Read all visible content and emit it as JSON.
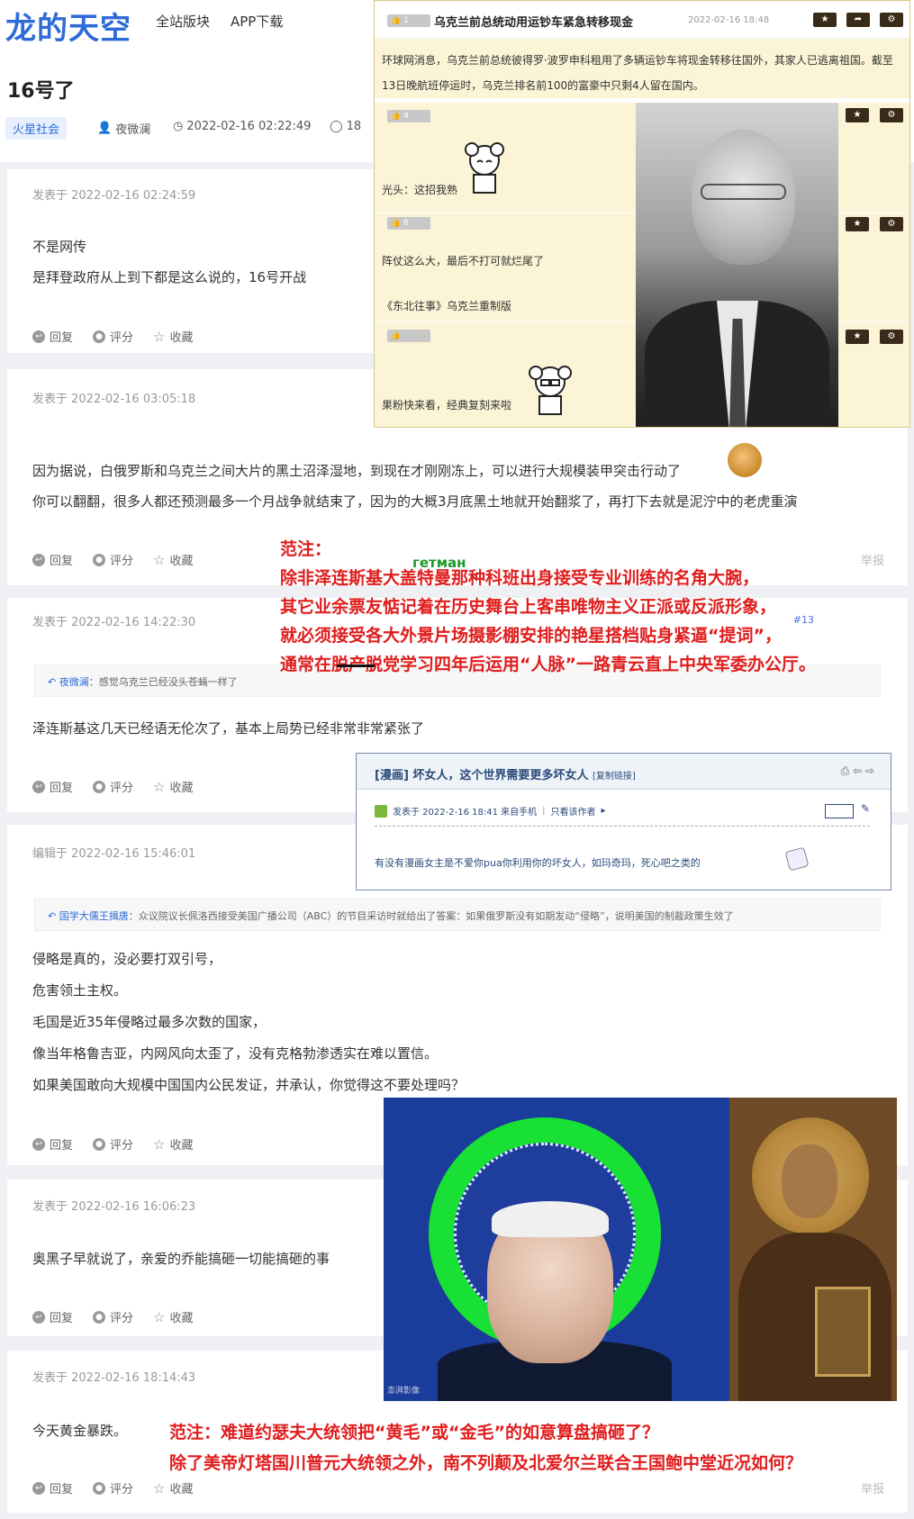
{
  "header": {
    "logo": "龙的天空",
    "nav": [
      "全站版块",
      "APP下载"
    ],
    "thread_title": "16号了",
    "category": "火星社会",
    "author": "夜微澜",
    "datetime": "2022-02-16 02:22:49",
    "reply_count": "18"
  },
  "labels": {
    "posted_at_prefix": "发表于",
    "edited_at_prefix": "编辑于",
    "reply": "回复",
    "rate": "评分",
    "favorite": "收藏",
    "report": "举报"
  },
  "posts": [
    {
      "date": "发表于 2022-02-16 02:24:59",
      "lines": [
        "不是网传",
        "是拜登政府从上到下都是这么说的，16号开战"
      ]
    },
    {
      "date": "发表于 2022-02-16 03:05:18",
      "lines": [
        "因为据说，白俄罗斯和乌克兰之间大片的黑土沼泽湿地，到现在才刚刚冻上，可以进行大规模装甲突击行动了",
        "你可以翻翻，很多人都还预测最多一个月战争就结束了，因为的大概3月底黑土地就开始翻浆了，再打下去就是泥泞中的老虎重演"
      ],
      "report": "举报"
    },
    {
      "date": "发表于 2022-02-16 14:22:30",
      "floor": "#13",
      "quote_name": "夜微澜",
      "quote_text": "：感觉乌克兰已经没头苍蝇一样了",
      "lines": [
        "泽连斯基这几天已经语无伦次了，基本上局势已经非常非常紧张了"
      ]
    },
    {
      "date": "编辑于 2022-02-16 15:46:01",
      "quote_name": "国学大儒王揖唐",
      "quote_text": "：众议院议长佩洛西接受美国广播公司（ABC）的节目采访时就给出了答案：如果俄罗斯没有如期发动“侵略”，说明美国的制裁政策生效了",
      "lines": [
        "侵略是真的，没必要打双引号，",
        "危害领土主权。",
        "毛国是近35年侵略过最多次数的国家，",
        "像当年格鲁吉亚，内网风向太歪了，没有克格勃渗透实在难以置信。",
        "如果美国敢向大规模中国国内公民发证，并承认，你觉得这不要处理吗？"
      ]
    },
    {
      "date": "发表于 2022-02-16 16:06:23",
      "lines": [
        "奥黑子早就说了，亲爱的乔能搞砸一切能搞砸的事"
      ]
    },
    {
      "date": "发表于 2022-02-16 18:14:43",
      "lines": [
        "今天黄金暴跌。"
      ],
      "report": "举报"
    }
  ],
  "news_card": {
    "like_badge": "1",
    "title": "乌克兰前总统动用运钞车紧急转移现金",
    "time": "2022-02-16 18:48",
    "body": "环球网消息，乌克兰前总统彼得罗·波罗申科租用了多辆运钞车将现金转移往国外，其家人已逃离祖国。截至13日晚航班停运时，乌克兰排名前100的富豪中只剩4人留在国内。",
    "comments": [
      {
        "likes": "4",
        "text": "光头：这招我熟"
      },
      {
        "likes": "6",
        "text": "阵仗这么大，最后不打可就烂尾了",
        "extra": "《东北往事》乌克兰重制版"
      },
      {
        "likes": "",
        "text": "果粉快来看，经典复刻来啦"
      }
    ]
  },
  "annotations": {
    "green_word": "гетман",
    "red_block_1": [
      "范注：",
      "除非泽连斯基大盖特曼那种科班出身接受专业训练的名角大腕，",
      "其它业余票友惦记着在历史舞台上客串唯物主义正派或反派形象，",
      "就必须接受各大外景片场摄影棚安排的艳星搭档贴身紧逼“提词”，",
      "通常在脱产脱党学习四年后运用“人脉”一路青云直上中央军委办公厅。"
    ],
    "red_block_2": [
      "范注：难道约瑟夫大统领把“黄毛”或“金毛”的如意算盘搞砸了？",
      "除了美帝灯塔国川普元大统领之外，南不列颠及北爱尔兰联合王国鲍中堂近况如何？"
    ]
  },
  "forum_card": {
    "title": "[漫画] 坏女人，这个世界需要更多坏女人",
    "copy_link": "[复制链接]",
    "meta": "发表于 2022-2-16 18:41 来自手机",
    "only_author": "只看该作者",
    "body": "有没有漫画女主是不爱你pua你利用你的坏女人，如玛奇玛，死心吧之类的"
  },
  "image_combo": {
    "watermark": "澎湃影像"
  },
  "colors": {
    "brand": "#2e6bd8",
    "annotation_red": "#e01d1d",
    "annotation_green": "#1a9a2a"
  }
}
